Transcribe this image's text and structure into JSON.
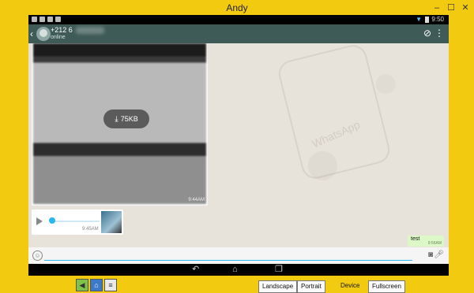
{
  "window": {
    "title": "Andy"
  },
  "statusbar": {
    "time": "9:50"
  },
  "chat_header": {
    "contact_name": "+212 6",
    "status": "online"
  },
  "messages": {
    "image": {
      "download_size": "75KB",
      "time": "9:44AM"
    },
    "audio": {
      "time": "9:45AM"
    },
    "outgoing": {
      "text": "test",
      "time": "9:56AM"
    }
  },
  "composer": {
    "value": "",
    "placeholder": ""
  },
  "bottom_bar": {
    "landscape": "Landscape",
    "portrait": "Portrait",
    "device": "Device",
    "fullscreen": "Fullscreen"
  },
  "colors": {
    "window_frame": "#f2cb10",
    "appbar": "#3f5b57",
    "accent": "#29b6f6",
    "outgoing_bubble": "#dcf8c6"
  }
}
